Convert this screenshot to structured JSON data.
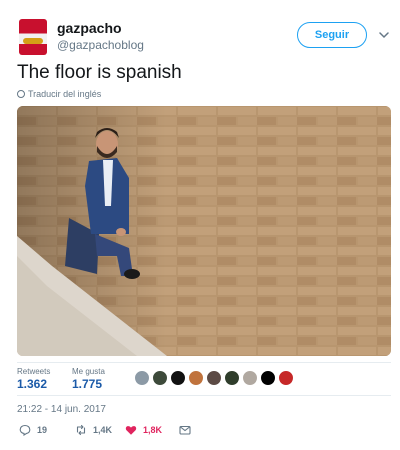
{
  "author": {
    "name": "gazpacho",
    "handle": "@gazpachoblog",
    "avatar_icon": "gazpacho-can-icon"
  },
  "follow_label": "Seguir",
  "tweet_text": "The floor is spanish",
  "translate_label": "Traducir del inglés",
  "stats": {
    "retweets_label": "Retweets",
    "retweets_value": "1.362",
    "likes_label": "Me gusta",
    "likes_value": "1.775",
    "liker_avatar_count": 9
  },
  "timestamp": "21:22 - 14 jun. 2017",
  "actions": {
    "replies": "19",
    "retweets": "1,4K",
    "likes": "1,8K"
  },
  "colors": {
    "accent": "#1da1f2",
    "like": "#e0245e",
    "secondary_text": "#657786",
    "stat_value": "#1b5aa8"
  }
}
